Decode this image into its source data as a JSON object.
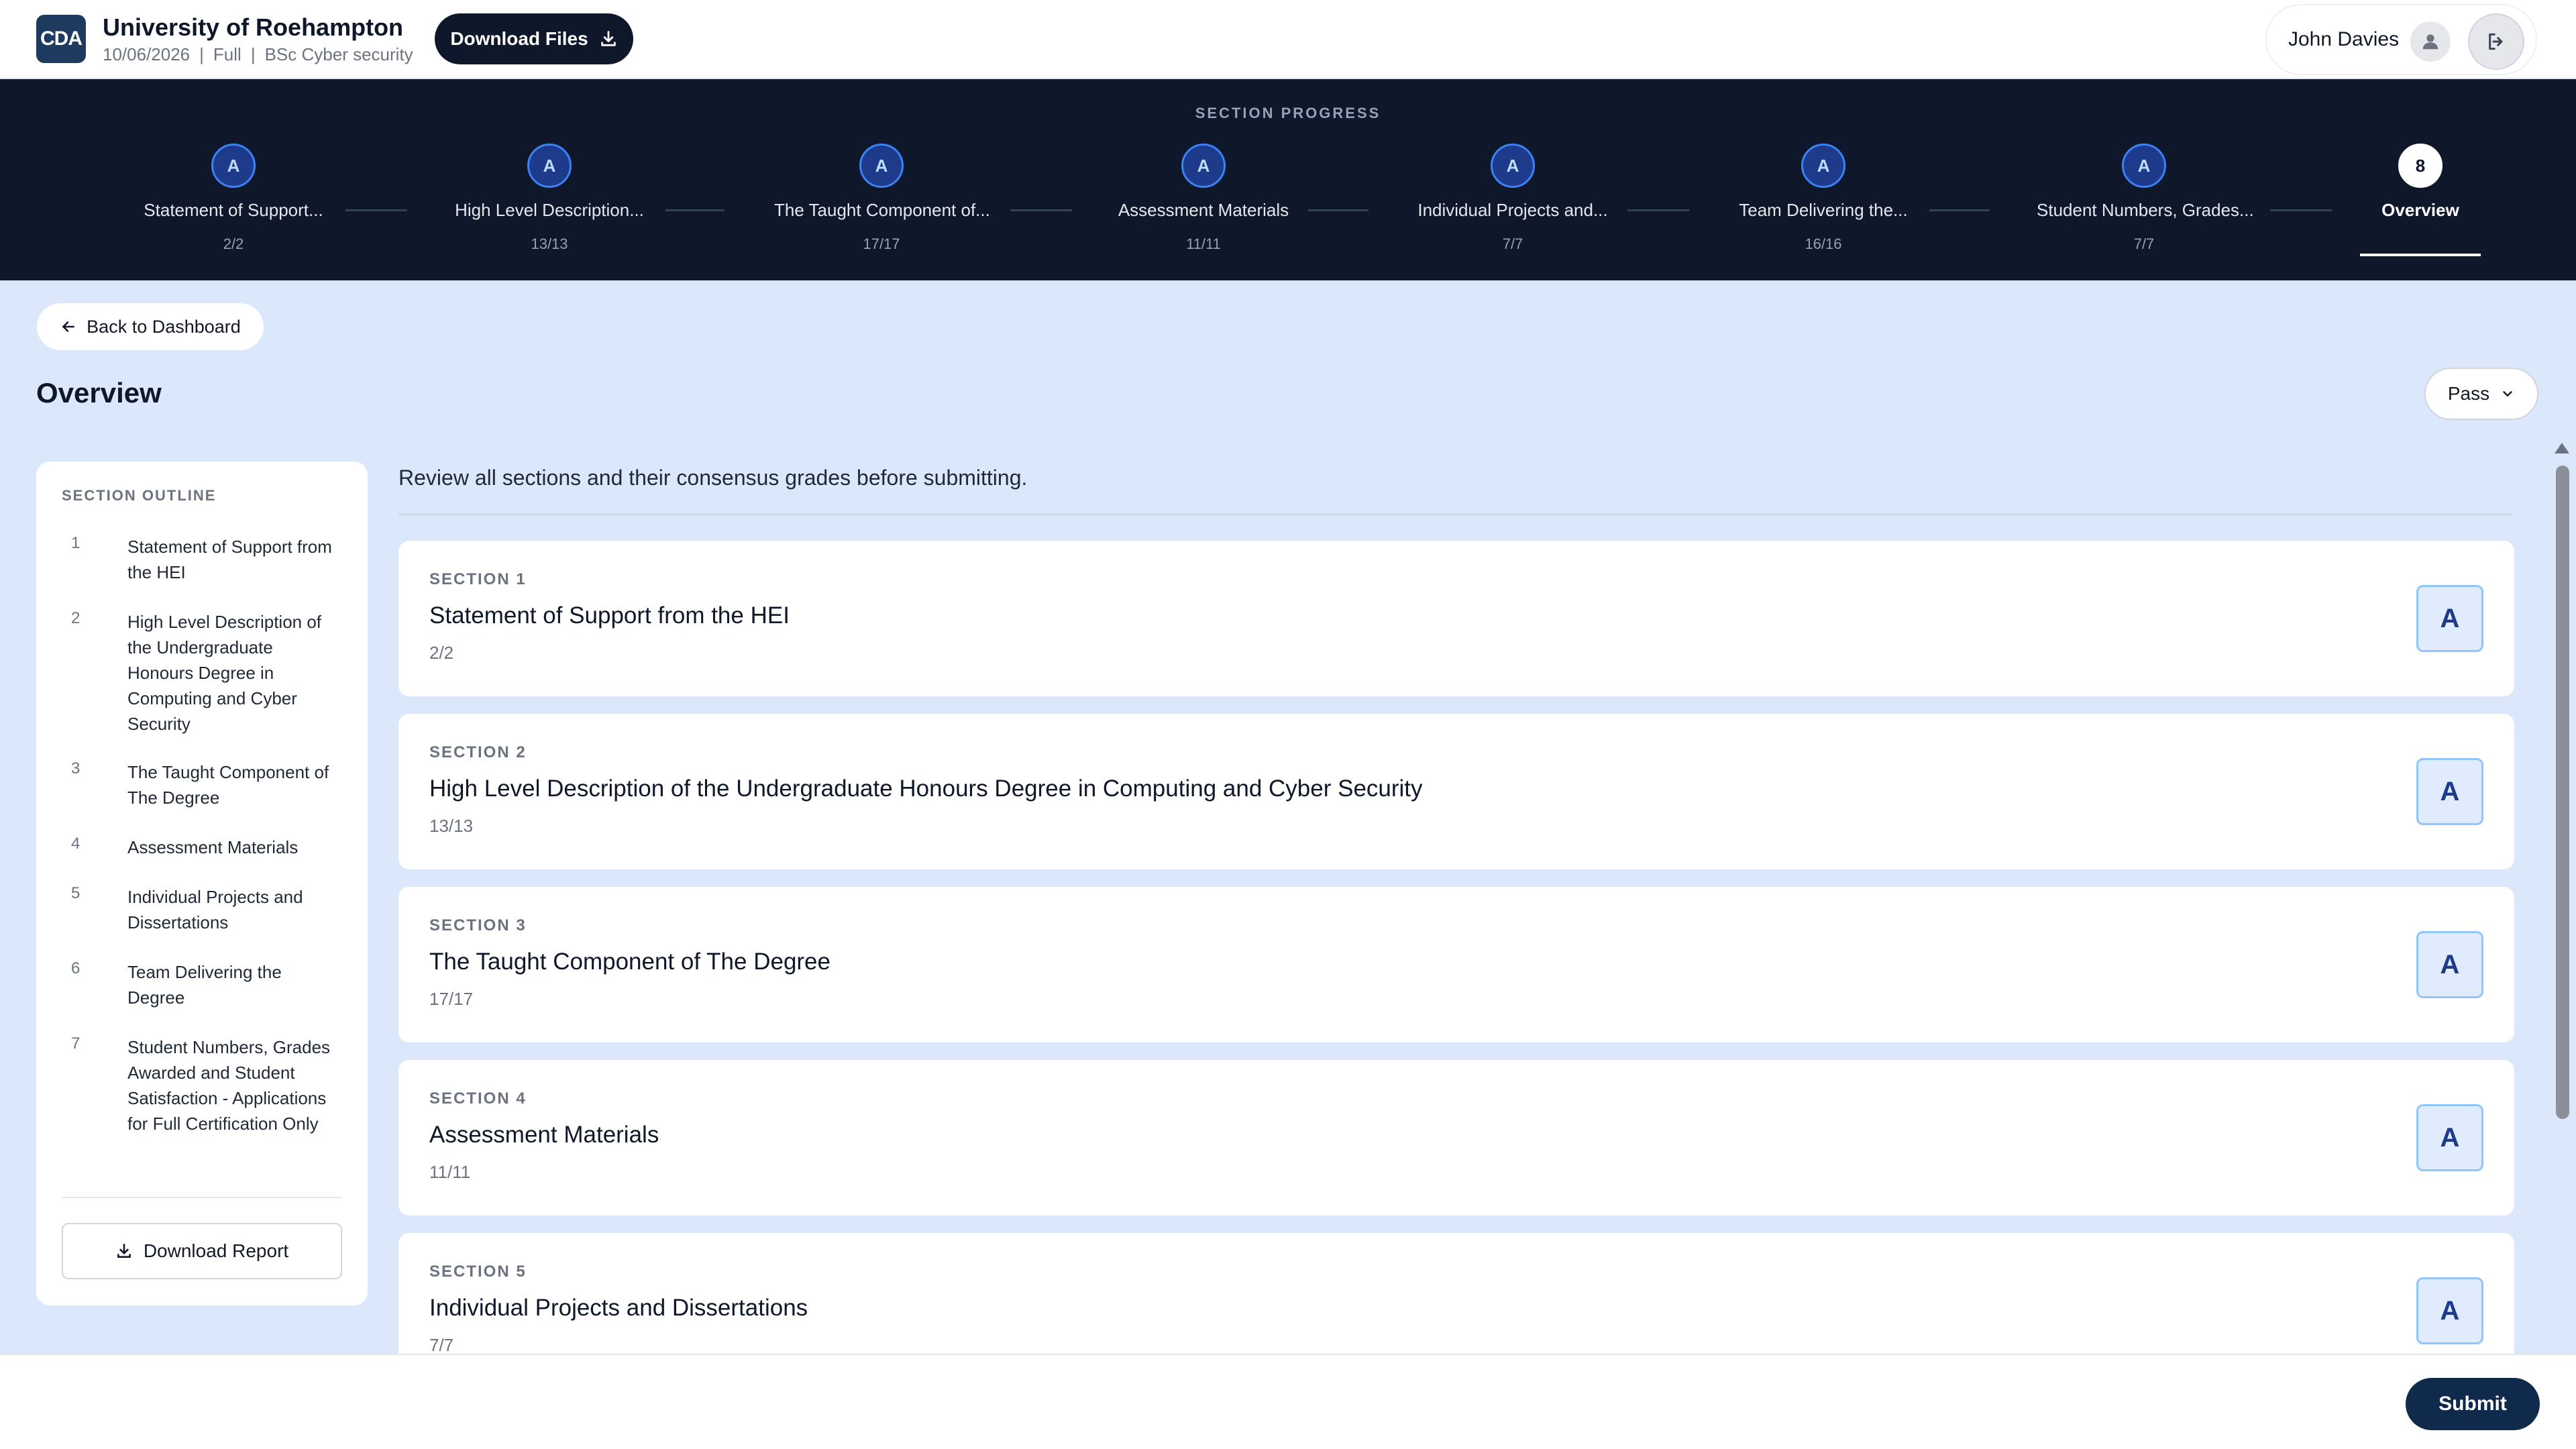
{
  "header": {
    "logo_text": "CDA",
    "university": "University of Roehampton",
    "date": "10/06/2026",
    "cert_type": "Full",
    "programme": "BSc Cyber security",
    "download_files_label": "Download Files",
    "user_name": "John Davies"
  },
  "progress": {
    "title": "SECTION PROGRESS",
    "steps": [
      {
        "badge": "A",
        "label": "Statement of Support...",
        "count": "2/2"
      },
      {
        "badge": "A",
        "label": "High Level Description...",
        "count": "13/13"
      },
      {
        "badge": "A",
        "label": "The Taught Component of...",
        "count": "17/17"
      },
      {
        "badge": "A",
        "label": "Assessment Materials",
        "count": "11/11"
      },
      {
        "badge": "A",
        "label": "Individual Projects and...",
        "count": "7/7"
      },
      {
        "badge": "A",
        "label": "Team Delivering the...",
        "count": "16/16"
      },
      {
        "badge": "A",
        "label": "Student Numbers, Grades...",
        "count": "7/7"
      },
      {
        "badge": "8",
        "label": "Overview",
        "count": ""
      }
    ]
  },
  "main": {
    "back_label": "Back to Dashboard",
    "title": "Overview",
    "grade_select": "Pass",
    "intro": "Review all sections and their consensus grades before submitting."
  },
  "outline": {
    "title": "SECTION OUTLINE",
    "items": [
      {
        "num": "1",
        "text": "Statement of Support from the HEI"
      },
      {
        "num": "2",
        "text": "High Level Description of the Undergraduate Honours Degree in Computing and Cyber Security"
      },
      {
        "num": "3",
        "text": "The Taught Component of The Degree"
      },
      {
        "num": "4",
        "text": "Assessment Materials"
      },
      {
        "num": "5",
        "text": "Individual Projects and Dissertations"
      },
      {
        "num": "6",
        "text": "Team Delivering the Degree"
      },
      {
        "num": "7",
        "text": "Student Numbers, Grades Awarded and Student Satisfaction - Applications for Full Certification Only"
      }
    ],
    "download_report_label": "Download Report"
  },
  "sections": [
    {
      "label": "SECTION 1",
      "title": "Statement of Support from the HEI",
      "count": "2/2",
      "grade": "A"
    },
    {
      "label": "SECTION 2",
      "title": "High Level Description of the Undergraduate Honours Degree in Computing and Cyber Security",
      "count": "13/13",
      "grade": "A"
    },
    {
      "label": "SECTION 3",
      "title": "The Taught Component of The Degree",
      "count": "17/17",
      "grade": "A"
    },
    {
      "label": "SECTION 4",
      "title": "Assessment Materials",
      "count": "11/11",
      "grade": "A"
    },
    {
      "label": "SECTION 5",
      "title": "Individual Projects and Dissertations",
      "count": "7/7",
      "grade": "A"
    }
  ],
  "footer": {
    "submit_label": "Submit"
  },
  "colors": {
    "navy": "#0f172a",
    "page_bg": "#dbe8fb",
    "accent_blue": "#3b82f6",
    "grade_bg": "#e0ecfd"
  }
}
